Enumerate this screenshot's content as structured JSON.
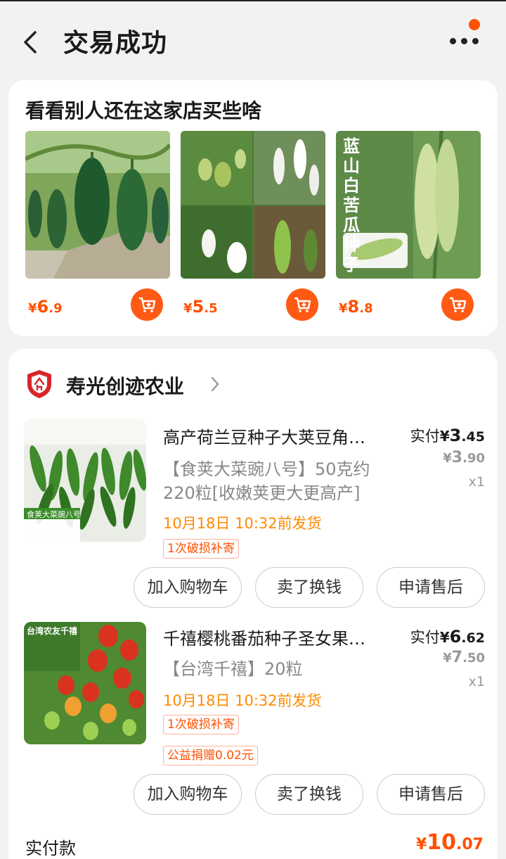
{
  "header": {
    "title": "交易成功",
    "back_icon": "chevron-left-icon",
    "more_icon": "more-dots-icon",
    "notify_color": "#ff5000"
  },
  "recommend": {
    "title": "看看别人还在这家店买些啥",
    "items": [
      {
        "image": "winter-melon-photo",
        "price_currency": "¥",
        "price_int": "6",
        "price_dec": ".9"
      },
      {
        "image": "white-eggplant-photo",
        "price_currency": "¥",
        "price_int": "5",
        "price_dec": ".5"
      },
      {
        "image": "bitter-melon-photo",
        "image_caption": "蓝山白苦瓜种子",
        "price_currency": "¥",
        "price_int": "8",
        "price_dec": ".8"
      }
    ],
    "cart_icon": "add-to-cart-icon"
  },
  "order": {
    "shop_name": "寿光创迹农业",
    "shop_logo": "shop-shield-logo-icon",
    "items": [
      {
        "image": "snow-pea-photo",
        "image_caption": "食荚大菜豌八号",
        "title": "高产荷兰豆种子大荚豆角…",
        "sku_line1": "【食荚大菜豌八号】50克约",
        "sku_line2": "220粒[收嫩荚更大更高产]",
        "ship": "10月18日 10:32前发货",
        "tags": [
          "1次破损补寄"
        ],
        "paid_label": "实付",
        "paid_currency": "¥",
        "paid_int": "3",
        "paid_dec": ".45",
        "orig_currency": "¥",
        "orig_int": "3",
        "orig_dec": ".90",
        "qty": "x1",
        "buttons": [
          "加入购物车",
          "卖了换钱",
          "申请售后"
        ]
      },
      {
        "image": "cherry-tomato-photo",
        "image_caption": "台湾农友千禧",
        "title": "千禧樱桃番茄种子圣女果…",
        "sku_line1": "【台湾千禧】20粒",
        "ship": "10月18日 10:32前发货",
        "tags": [
          "1次破损补寄",
          "公益捐赠0.02元"
        ],
        "paid_label": "实付",
        "paid_currency": "¥",
        "paid_int": "6",
        "paid_dec": ".62",
        "orig_currency": "¥",
        "orig_int": "7",
        "orig_dec": ".50",
        "qty": "x1",
        "buttons": [
          "加入购物车",
          "卖了换钱",
          "申请售后"
        ]
      }
    ],
    "total_label": "实付款",
    "total_currency": "¥",
    "total_int": "10",
    "total_dec": ".07",
    "accent": "#ff5000"
  }
}
